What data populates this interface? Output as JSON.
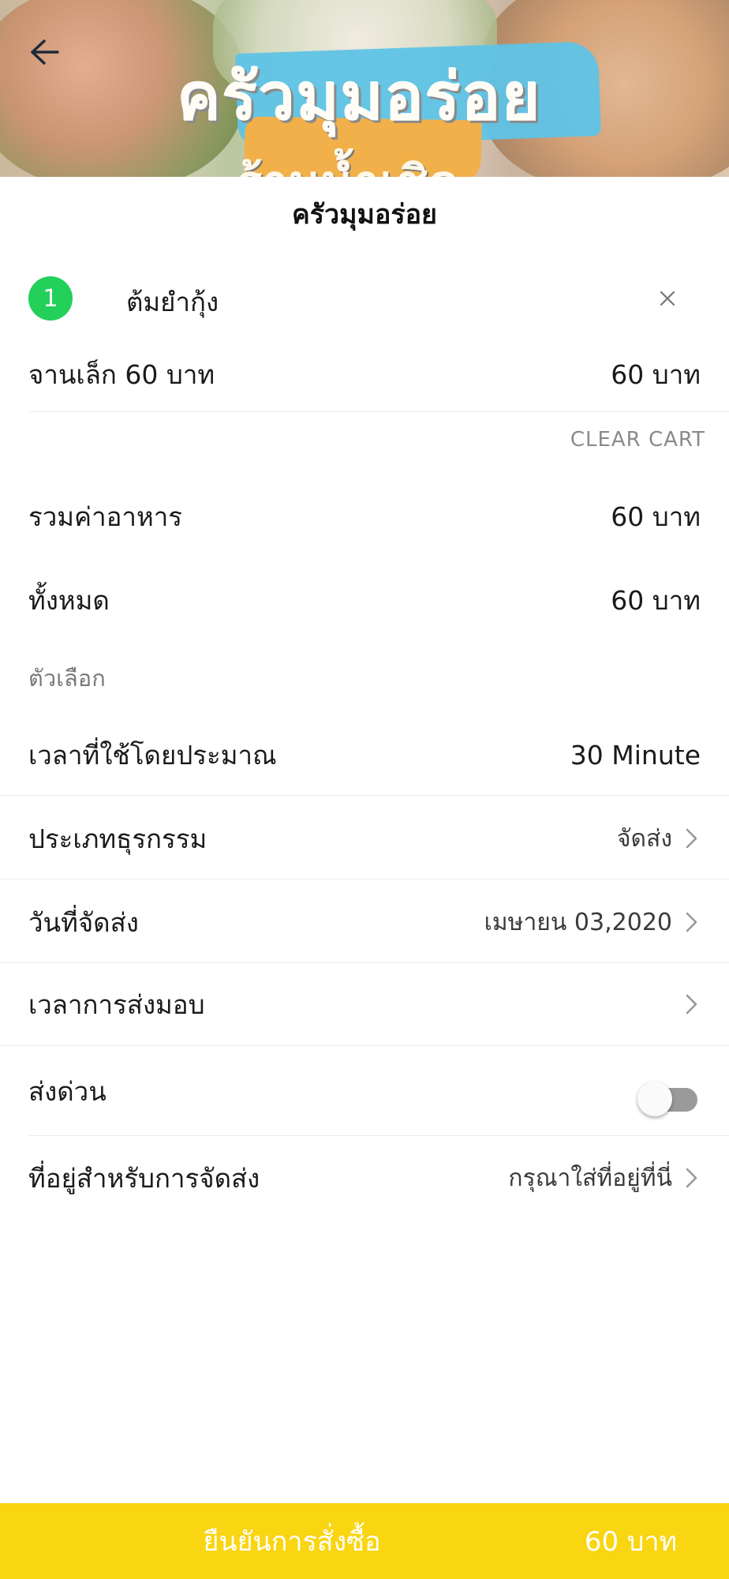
{
  "header": {
    "banner_text": "ครัวมุมอร่อย",
    "banner_subtext": "ร้านน้ำเชิด",
    "title": "ครัวมุมอร่อย"
  },
  "cart": {
    "items": [
      {
        "qty": "1",
        "name": "ต้มยำกุ้ง",
        "option": "จานเล็ก 60 บาท",
        "price": "60 บาท"
      }
    ],
    "clear_label": "CLEAR CART"
  },
  "summary": {
    "food_total_label": "รวมค่าอาหาร",
    "food_total_value": "60 บาท",
    "grand_total_label": "ทั้งหมด",
    "grand_total_value": "60 บาท"
  },
  "options": {
    "section_label": "ตัวเลือก",
    "est_time_label": "เวลาที่ใช้โดยประมาณ",
    "est_time_value": "30 Minute",
    "business_type_label": "ประเภทธุรกรรม",
    "business_type_value": "จัดส่ง",
    "delivery_date_label": "วันที่จัดส่ง",
    "delivery_date_value": "เมษายน 03,2020",
    "delivery_time_label": "เวลาการส่งมอบ",
    "delivery_time_value": "",
    "express_label": "ส่งด่วน",
    "express_on": false,
    "address_label": "ที่อยู่สำหรับการจัดส่ง",
    "address_placeholder": "กรุณาใส่ที่อยู่ที่นี่"
  },
  "footer": {
    "confirm_label": "ยืนยันการสั่งซื้อ",
    "total": "60 บาท"
  },
  "colors": {
    "accent_yellow": "#f9d512",
    "badge_green": "#22d05a"
  }
}
